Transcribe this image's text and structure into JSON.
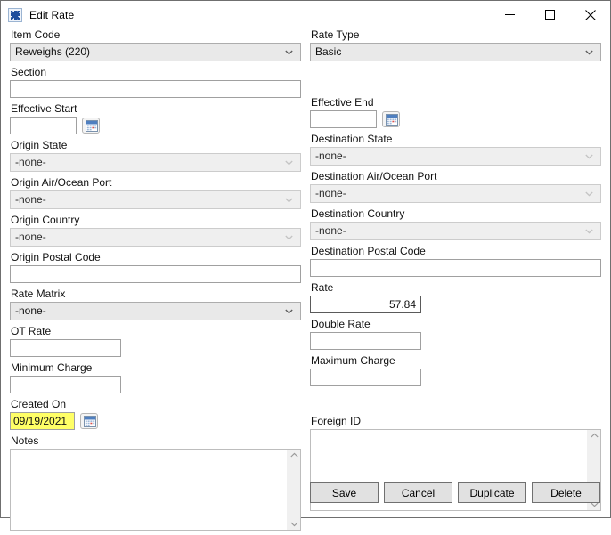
{
  "window": {
    "title": "Edit Rate",
    "icon": "gear-icon",
    "controls": {
      "minimize": "minimize-icon",
      "maximize": "maximize-icon",
      "close": "close-icon"
    }
  },
  "form": {
    "left": {
      "item_code": {
        "label": "Item Code",
        "value": "Reweighs (220)",
        "type": "combobox",
        "enabled": true
      },
      "section": {
        "label": "Section",
        "value": "",
        "placeholder": "",
        "type": "text"
      },
      "effective_start": {
        "label": "Effective Start",
        "value": "",
        "placeholder": "",
        "type": "date",
        "picker_icon": "calendar-icon"
      },
      "origin_state": {
        "label": "Origin State",
        "value": "-none-",
        "type": "combobox",
        "enabled": false
      },
      "origin_air_ocean_port": {
        "label": "Origin Air/Ocean Port",
        "value": "-none-",
        "type": "combobox",
        "enabled": false
      },
      "origin_country": {
        "label": "Origin Country",
        "value": "-none-",
        "type": "combobox",
        "enabled": false
      },
      "origin_postal_code": {
        "label": "Origin Postal Code",
        "value": "",
        "type": "text"
      },
      "rate_matrix": {
        "label": "Rate Matrix",
        "value": "-none-",
        "type": "combobox",
        "enabled": true
      },
      "ot_rate": {
        "label": "OT Rate",
        "value": "",
        "type": "text"
      },
      "minimum_charge": {
        "label": "Minimum Charge",
        "value": "",
        "type": "text"
      },
      "created_on": {
        "label": "Created On",
        "value": "09/19/2021",
        "type": "date",
        "highlight_color": "#ffff66",
        "picker_icon": "calendar-icon"
      },
      "notes": {
        "label": "Notes",
        "value": "",
        "type": "textarea"
      }
    },
    "right": {
      "rate_type": {
        "label": "Rate Type",
        "value": "Basic",
        "type": "combobox",
        "enabled": true
      },
      "effective_end": {
        "label": "Effective End",
        "value": "",
        "type": "date",
        "picker_icon": "calendar-icon"
      },
      "destination_state": {
        "label": "Destination State",
        "value": "-none-",
        "type": "combobox",
        "enabled": false
      },
      "destination_air_ocean_port": {
        "label": "Destination Air/Ocean Port",
        "value": "-none-",
        "type": "combobox",
        "enabled": false
      },
      "destination_country": {
        "label": "Destination Country",
        "value": "-none-",
        "type": "combobox",
        "enabled": false
      },
      "destination_postal_code": {
        "label": "Destination Postal Code",
        "value": "",
        "type": "text"
      },
      "rate": {
        "label": "Rate",
        "value": "57.84",
        "type": "number",
        "focused": true
      },
      "double_rate": {
        "label": "Double Rate",
        "value": "",
        "type": "number"
      },
      "maximum_charge": {
        "label": "Maximum Charge",
        "value": "",
        "type": "number"
      },
      "foreign_id": {
        "label": "Foreign ID",
        "value": "",
        "type": "textarea"
      }
    }
  },
  "buttons": {
    "save": "Save",
    "cancel": "Cancel",
    "duplicate": "Duplicate",
    "delete": "Delete"
  },
  "colors": {
    "highlight": "#ffff66",
    "combo_disabled_bg": "#efefef",
    "combo_enabled_bg": "#e9e9e9",
    "button_bg": "#e1e1e1",
    "window_border": "#6f6f6f"
  }
}
